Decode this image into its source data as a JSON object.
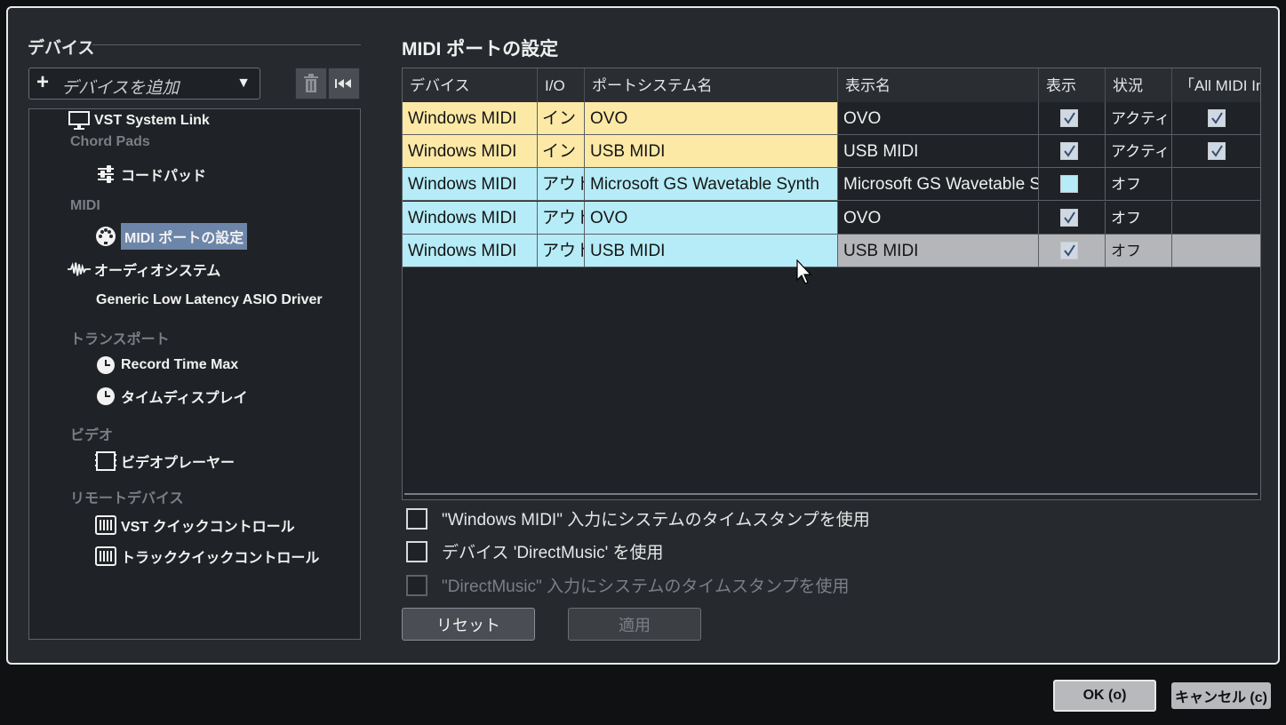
{
  "left": {
    "section_title": "デバイス",
    "add_device_label": "デバイスを追加",
    "tree": [
      {
        "type": "category",
        "label": "Chord Pads"
      },
      {
        "type": "item",
        "label": "コードパッド",
        "icon": "sliders-icon"
      },
      {
        "type": "category",
        "label": "MIDI"
      },
      {
        "type": "item",
        "label": "MIDI ポートの設定",
        "icon": "midi-port-icon",
        "selected": true
      },
      {
        "type": "item",
        "label": "オーディオシステム",
        "icon": "waveform-icon"
      },
      {
        "type": "item",
        "label": "Generic Low Latency ASIO Driver",
        "icon": ""
      },
      {
        "type": "category",
        "label": "トランスポート"
      },
      {
        "type": "item",
        "label": "Record Time Max",
        "icon": "clock-icon"
      },
      {
        "type": "item",
        "label": "タイムディスプレイ",
        "icon": "clock-icon"
      },
      {
        "type": "category",
        "label": "ビデオ"
      },
      {
        "type": "item",
        "label": "ビデオプレーヤー",
        "icon": "film-icon"
      },
      {
        "type": "category",
        "label": "リモートデバイス"
      },
      {
        "type": "item",
        "label": "VST クイックコントロール",
        "icon": "keyboard-icon"
      },
      {
        "type": "item",
        "label": "トラッククイックコントロール",
        "icon": "keyboard-icon"
      },
      {
        "type": "item",
        "label": "VST System Link",
        "icon": "monitor-icon"
      }
    ]
  },
  "right": {
    "title": "MIDI ポートの設定",
    "columns": [
      "デバイス",
      "I/O",
      "ポートシステム名",
      "表示名",
      "表示",
      "状況",
      "「All MIDI In"
    ],
    "rows": [
      {
        "device": "Windows MIDI",
        "io": "イン",
        "port": "OVO",
        "display": "OVO",
        "visible": true,
        "status": "アクティブ",
        "all_midi": true,
        "kind": "in"
      },
      {
        "device": "Windows MIDI",
        "io": "イン",
        "port": "USB MIDI",
        "display": "USB MIDI",
        "visible": true,
        "status": "アクティブ",
        "all_midi": true,
        "kind": "in"
      },
      {
        "device": "Windows MIDI",
        "io": "アウト",
        "port": "Microsoft GS Wavetable Synth",
        "display": "Microsoft GS Wavetable Synth",
        "visible": false,
        "status": "オフ",
        "all_midi": null,
        "kind": "out"
      },
      {
        "device": "Windows MIDI",
        "io": "アウト",
        "port": "OVO",
        "display": "OVO",
        "visible": true,
        "status": "オフ",
        "all_midi": null,
        "kind": "out"
      },
      {
        "device": "Windows MIDI",
        "io": "アウト",
        "port": "USB MIDI",
        "display": "USB MIDI",
        "visible": true,
        "status": "オフ",
        "all_midi": null,
        "kind": "out",
        "highlighted": true
      }
    ],
    "options": [
      {
        "label": "\"Windows MIDI\" 入力にシステムのタイムスタンプを使用",
        "checked": false,
        "disabled": false
      },
      {
        "label": "デバイス 'DirectMusic' を使用",
        "checked": false,
        "disabled": false
      },
      {
        "label": "\"DirectMusic\" 入力にシステムのタイムスタンプを使用",
        "checked": false,
        "disabled": true
      }
    ],
    "reset_label": "リセット",
    "apply_label": "適用"
  },
  "footer": {
    "ok_label": "OK (o)",
    "cancel_label": "キャンセル (c)"
  },
  "colors": {
    "in_row": "#fde9a6",
    "out_row": "#b5ecf7",
    "highlight": "#b4b6b9",
    "selected_item": "#6c85a8"
  }
}
